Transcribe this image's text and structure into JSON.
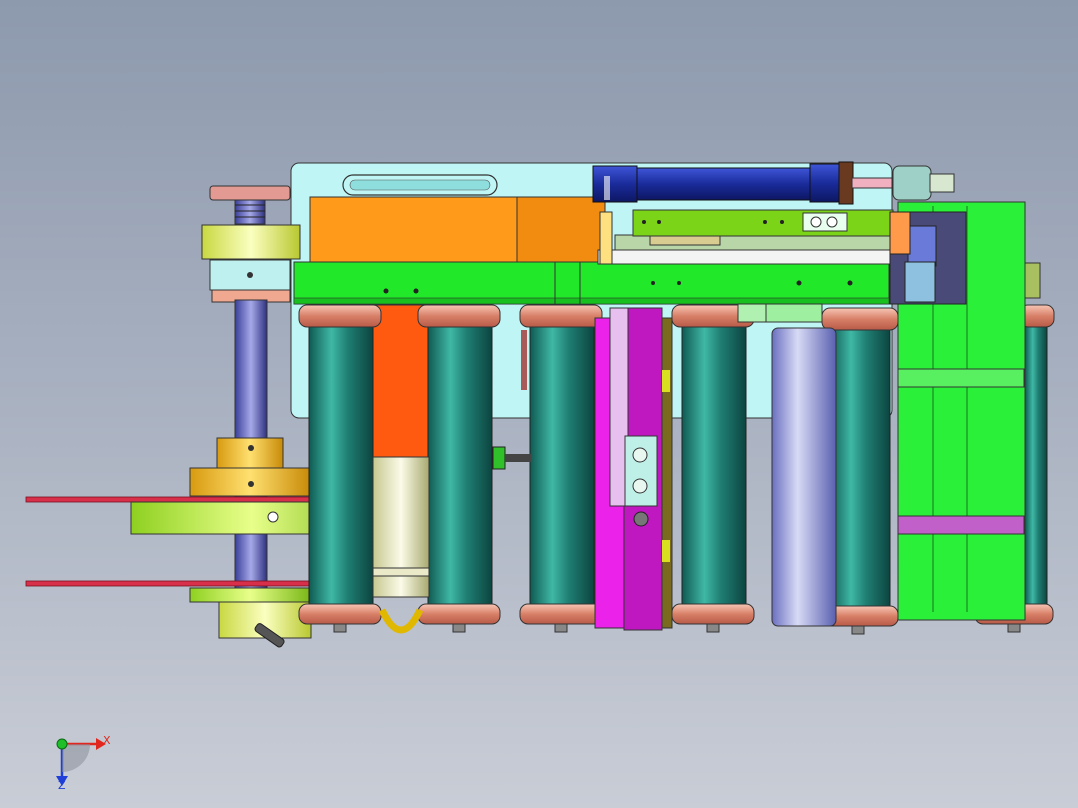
{
  "triad": {
    "x_label": "X",
    "z_label": "Z",
    "x_color": "#e0261f",
    "z_color": "#1f3fd8",
    "y_color": "#1fbf2a"
  },
  "colors": {
    "background_top": "#8d99ad",
    "background_bottom": "#c9cdd6",
    "frame_plate": "#bff5f5",
    "beam_green": "#22e82a",
    "block_orange": "#ff9a1a",
    "roller_teal": "#1f7f73",
    "roller_flange": "#e8a08a",
    "cylinder_blue": "#1b2fa8",
    "bracket_magenta": "#e020e0",
    "panel_green": "#2bf03a",
    "collar_yellow": "#f0c020",
    "disc_red": "#d8304a",
    "spacer_lime": "#a8e83a"
  },
  "rollers": {
    "count": 7
  }
}
